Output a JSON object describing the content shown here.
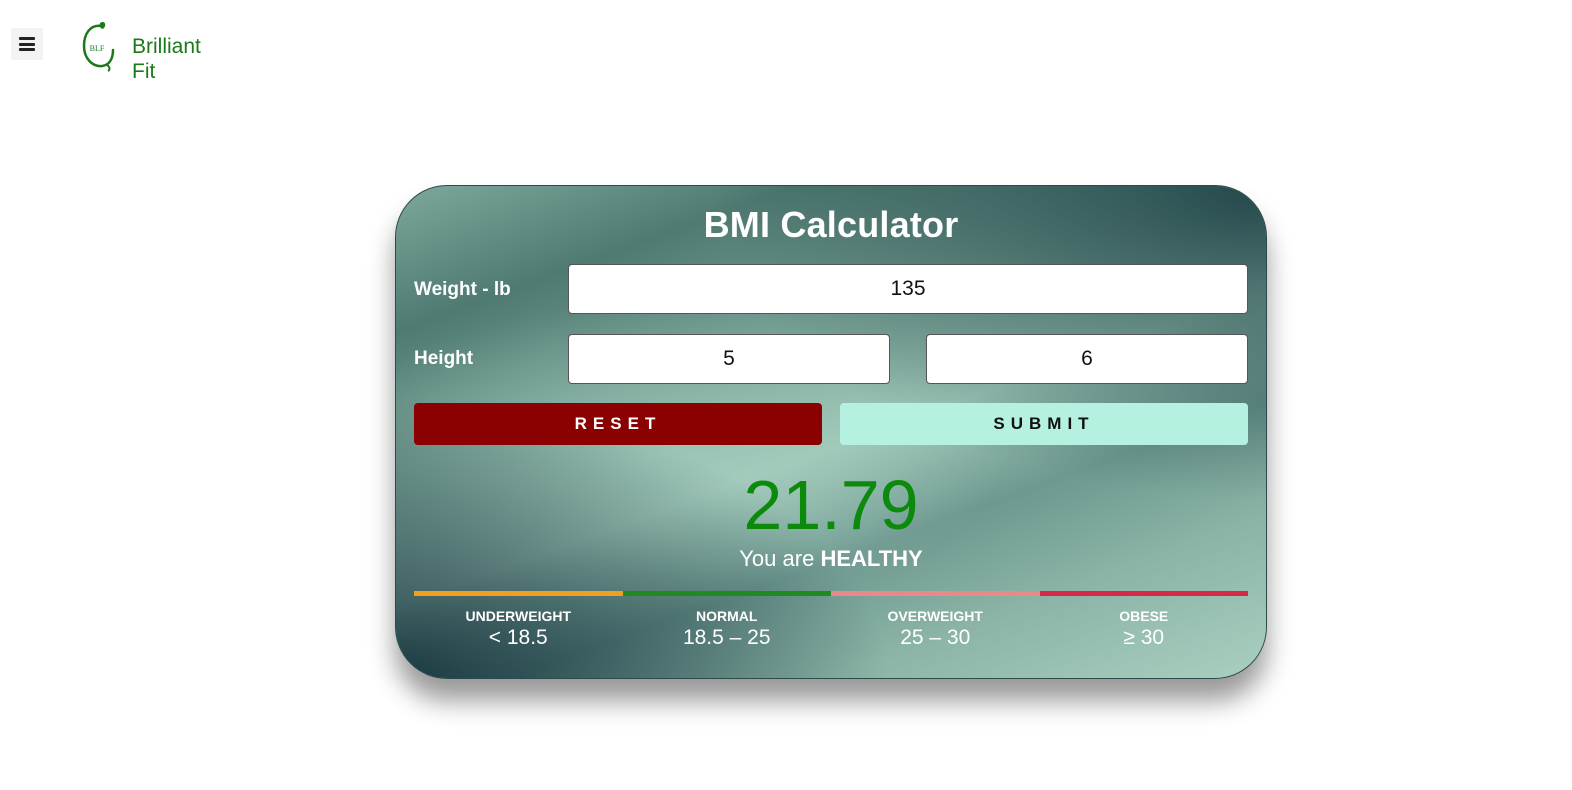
{
  "header": {
    "menu_icon": "hamburger-menu-icon",
    "brand": {
      "logo_text": "BLF",
      "name_line1": "Brilliant",
      "name_line2": "Fit",
      "color": "#1a7a1a"
    }
  },
  "calculator": {
    "title": "BMI Calculator",
    "weight": {
      "label": "Weight - lb",
      "value": "135"
    },
    "height": {
      "label": "Height",
      "feet_value": "5",
      "inches_value": "6"
    },
    "buttons": {
      "reset_label": "RESET",
      "submit_label": "SUBMIT",
      "reset_color": "#8b0000",
      "submit_color": "#b4f1e1"
    },
    "result": {
      "value": "21.79",
      "prefix": "You are",
      "status": "HEALTHY",
      "value_color": "#0c8a0c"
    },
    "scale": [
      {
        "name": "UNDERWEIGHT",
        "range": "< 18.5",
        "color": "#f0a020"
      },
      {
        "name": "NORMAL",
        "range": "18.5 – 25",
        "color": "#1f8a1f"
      },
      {
        "name": "OVERWEIGHT",
        "range": "25 – 30",
        "color": "#e88a8a"
      },
      {
        "name": "OBESE",
        "range": "≥ 30",
        "color": "#d62848"
      }
    ]
  }
}
